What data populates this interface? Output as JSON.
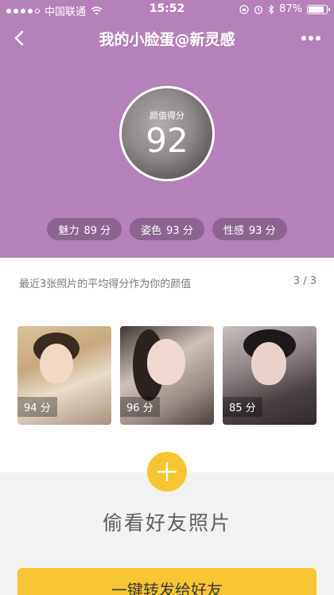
{
  "status_bar": {
    "carrier": "中国联通",
    "time": "15:52",
    "battery": "87%",
    "battery_level": 0.87,
    "signal_bars": 4,
    "icons": [
      "wifi-icon",
      "rotation-lock-icon",
      "alarm-icon",
      "bluetooth-icon",
      "battery-icon"
    ]
  },
  "nav": {
    "title": "我的小脸蛋@新灵感",
    "back_icon": "chevron-left-icon",
    "more_icon": "more-dots-icon"
  },
  "score": {
    "label": "颜值得分",
    "value": "92"
  },
  "traits": [
    {
      "name": "魅力",
      "value": "89 分"
    },
    {
      "name": "姿色",
      "value": "93 分"
    },
    {
      "name": "性感",
      "value": "93 分"
    }
  ],
  "info": {
    "description": "最近3张照片的平均得分作为你的颜值",
    "counter": "3 / 3"
  },
  "photos": [
    {
      "score": "94 分"
    },
    {
      "score": "96 分"
    },
    {
      "score": "85 分"
    }
  ],
  "peek": {
    "title": "偷看好友照片",
    "plus_icon": "plus-icon"
  },
  "share_button": "一键转发给好友",
  "colors": {
    "header_bg": "#b481b8",
    "accent_yellow": "#f7c531",
    "pill_bg": "#7f5e86"
  }
}
